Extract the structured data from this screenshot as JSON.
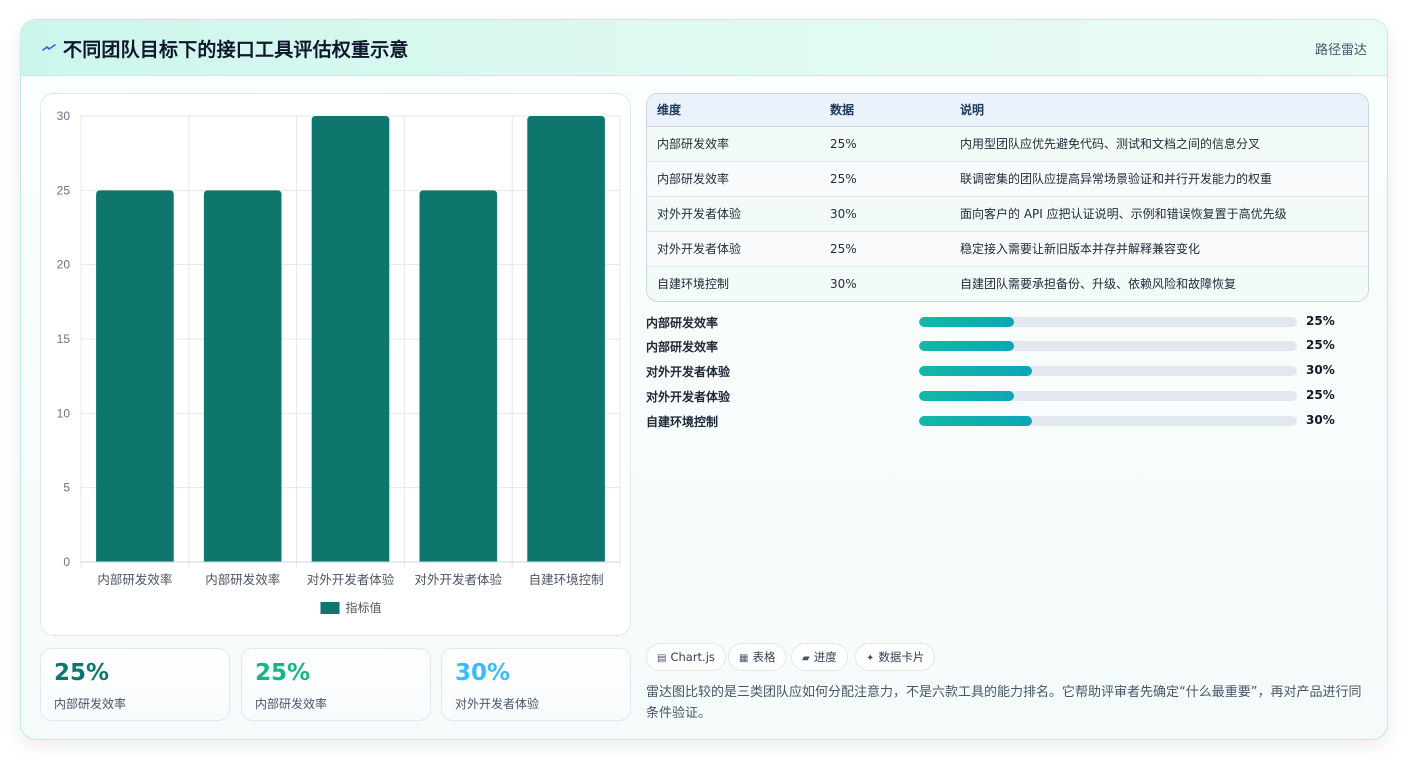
{
  "header": {
    "icon": "lightning-icon",
    "title": "不同团队目标下的接口工具评估权重示意",
    "link": "路径雷达"
  },
  "chart_data": {
    "type": "bar",
    "categories": [
      "内部研发效率",
      "内部研发效率",
      "对外开发者体验",
      "对外开发者体验",
      "自建环境控制"
    ],
    "series": [
      {
        "name": "指标值",
        "values": [
          25,
          25,
          30,
          25,
          30
        ]
      }
    ],
    "yticks": [
      "0",
      "5",
      "10",
      "15",
      "20",
      "25",
      "30"
    ],
    "ylim": [
      0,
      30
    ],
    "grid": true,
    "legend": "bottom",
    "bar_color": "#0f766e"
  },
  "stats": [
    {
      "value": "25%",
      "label": "内部研发效率",
      "color": "#0f766e"
    },
    {
      "value": "25%",
      "label": "内部研发效率",
      "color": "#10b981"
    },
    {
      "value": "30%",
      "label": "对外开发者体验",
      "color": "#38bdf8"
    }
  ],
  "table": {
    "headers": [
      "维度",
      "数据",
      "说明"
    ],
    "rows": [
      [
        "内部研发效率",
        "25%",
        "内用型团队应优先避免代码、测试和文档之间的信息分叉"
      ],
      [
        "内部研发效率",
        "25%",
        "联调密集的团队应提高异常场景验证和并行开发能力的权重"
      ],
      [
        "对外开发者体验",
        "30%",
        "面向客户的 API 应把认证说明、示例和错误恢复置于高优先级"
      ],
      [
        "对外开发者体验",
        "25%",
        "稳定接入需要让新旧版本并存并解释兼容变化"
      ],
      [
        "自建环境控制",
        "30%",
        "自建团队需要承担备份、升级、依赖风险和故障恢复"
      ]
    ]
  },
  "progress": [
    {
      "label": "内部研发效率",
      "value": "25%",
      "fraction": 0.25
    },
    {
      "label": "内部研发效率",
      "value": "25%",
      "fraction": 0.25
    },
    {
      "label": "对外开发者体验",
      "value": "30%",
      "fraction": 0.3
    },
    {
      "label": "对外开发者体验",
      "value": "25%",
      "fraction": 0.25
    },
    {
      "label": "自建环境控制",
      "value": "30%",
      "fraction": 0.3
    }
  ],
  "chips": [
    {
      "icon": "chart-icon",
      "glyph": "▤",
      "label": "Chart.js"
    },
    {
      "icon": "table-icon",
      "glyph": "▦",
      "label": "表格"
    },
    {
      "icon": "progress-icon",
      "glyph": "▰",
      "label": "进度"
    },
    {
      "icon": "sparkle-icon",
      "glyph": "✦",
      "label": "数据卡片"
    }
  ],
  "footnote": "雷达图比较的是三类团队应如何分配注意力，不是六款工具的能力排名。它帮助评审者先确定“什么最重要”，再对产品进行同条件验证。"
}
